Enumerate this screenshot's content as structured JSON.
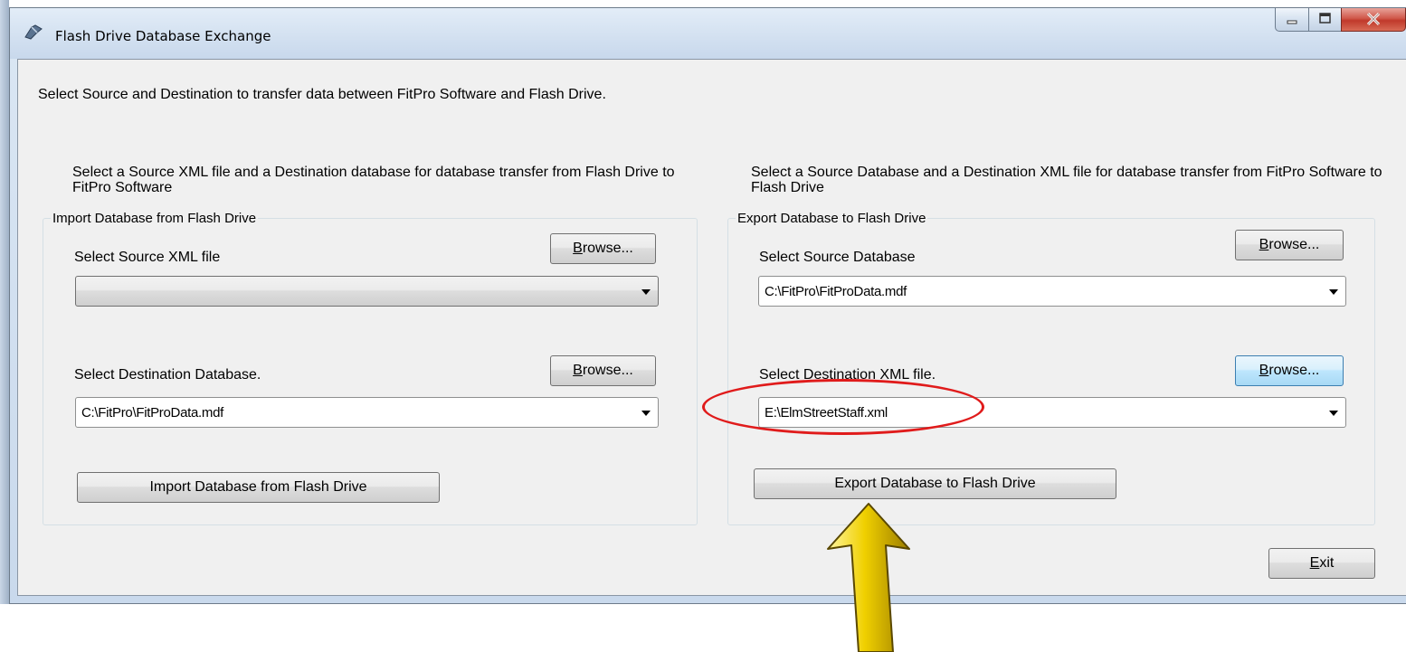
{
  "window": {
    "title": "Flash Drive Database Exchange"
  },
  "intro_text": "Select Source and Destination to transfer data between FitPro Software and Flash Drive.",
  "import": {
    "description": "Select a Source XML file and a Destination database for database transfer from Flash Drive to FitPro Software",
    "group_title": "Import Database from Flash Drive",
    "source_label": "Select Source XML file",
    "source_value": "",
    "browse_mnemonic": "B",
    "browse_rest": "rowse...",
    "dest_label": "Select Destination Database.",
    "dest_value": "C:\\FitPro\\FitProData.mdf",
    "action_label": "Import Database from Flash Drive"
  },
  "export": {
    "description": "Select a Source Database and a Destination XML file for database transfer from FitPro Software to Flash Drive",
    "group_title": "Export Database to Flash Drive",
    "source_label": "Select Source Database",
    "source_value": "C:\\FitPro\\FitProData.mdf",
    "browse_mnemonic": "B",
    "browse_rest": "rowse...",
    "dest_label": "Select Destination XML file.",
    "dest_value": "E:\\ElmStreetStaff.xml",
    "action_label": "Export  Database to Flash Drive"
  },
  "exit": {
    "mnemonic": "E",
    "rest": "xit"
  },
  "colors": {
    "annotation_ellipse": "#e01b1b",
    "annotation_arrow": "#f0d000"
  },
  "icons": {
    "app": "tools-icon",
    "minimize": "minimize-icon",
    "maximize": "maximize-icon",
    "close": "close-icon",
    "dropdown": "chevron-down-icon",
    "annotation": "up-arrow-icon"
  }
}
